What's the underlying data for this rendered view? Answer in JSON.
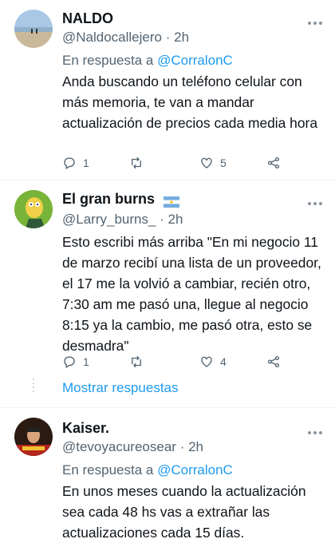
{
  "tweets": [
    {
      "name": "NALDO",
      "handle": "@Naldocallejero",
      "time": "· 2h",
      "reply_prefix": "En respuesta a ",
      "reply_mention": "@CorralonC",
      "text": "Anda buscando un teléfono celular con más memoria, te van a mandar actualización de precios cada media hora",
      "replies": "1",
      "retweets": "",
      "likes": "5"
    },
    {
      "name": "El gran burns",
      "handle": "@Larry_burns_",
      "time": "· 2h",
      "text": "Esto escribi más arriba \"En mi negocio 11 de marzo recibí una lista de un proveedor, el 17 me la volvió a cambiar, recién otro, 7:30 am me pasó una, llegue al negocio 8:15 ya la cambio, me pasó otra, esto se desmadra\"",
      "replies": "1",
      "retweets": "",
      "likes": "4",
      "show_replies": "Mostrar respuestas"
    },
    {
      "name": "Kaiser.",
      "handle": "@tevoyacureosear",
      "time": "· 2h",
      "reply_prefix": "En respuesta a ",
      "reply_mention": "@CorralonC",
      "text": "En unos meses cuando la actualización sea cada 48 hs vas a extrañar las actualizaciones cada 15 días."
    }
  ],
  "icons": [
    "reply-icon",
    "retweet-icon",
    "like-icon",
    "share-icon",
    "more-icon",
    "flag-icon"
  ],
  "colors": {
    "accent": "#1d9bf0",
    "secondary_text": "#536471",
    "primary_text": "#0f1419"
  }
}
